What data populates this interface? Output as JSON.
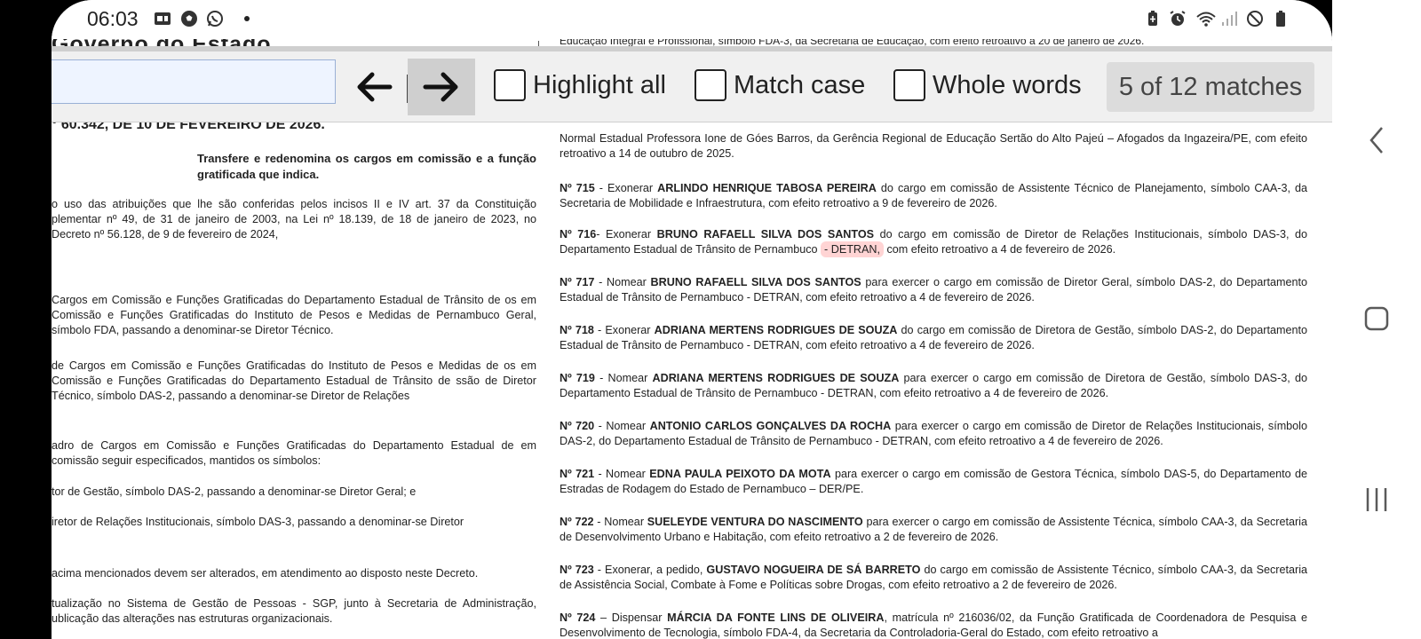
{
  "status_bar": {
    "time": "06:03",
    "left_icons": [
      "sim-card-icon",
      "football-icon",
      "whatsapp-icon"
    ],
    "right_icons": [
      "battery-saver-icon",
      "alarm-icon",
      "wifi-icon",
      "signal-icon",
      "do-not-disturb-icon",
      "battery-icon"
    ]
  },
  "find_bar": {
    "search_value": "",
    "prev_label": "←",
    "next_label": "→",
    "highlight_all": "Highlight all",
    "match_case": "Match case",
    "whole_words": "Whole words",
    "match_count": "5 of 12 matches"
  },
  "document": {
    "header_clipped": "Governo do Estado",
    "top_right_clipped": "Educação Integral e Profissional, símbolo FDA-3, da Secretaria de Educação, com efeito retroativo a 20 de janeiro de 2026.",
    "decree_title": "° 60.342, DE 10 DE FEVEREIRO DE 2026.",
    "ementa": "Transfere e redenomina os cargos em comissão e a função gratificada que indica.",
    "left_paragraphs": [
      "o uso das atribuições que lhe são conferidas pelos incisos II e IV art. 37 da Constituição plementar nº 49, de 31 de janeiro de 2003, na Lei nº 18.139, de 18 de janeiro de 2023, no Decreto nº 56.128, de 9 de fevereiro de 2024,",
      "Cargos em Comissão e Funções Gratificadas do Departamento Estadual de Trânsito de os em Comissão e Funções Gratificadas do Instituto de Pesos e Medidas de Pernambuco Geral, símbolo FDA, passando a denominar-se Diretor Técnico.",
      "de Cargos em Comissão e Funções Gratificadas do Instituto de Pesos e Medidas de os em Comissão e Funções Gratificadas do Departamento Estadual de Trânsito de ssão de Diretor Técnico, símbolo DAS-2, passando a denominar-se Diretor de Relações",
      "adro de Cargos em Comissão e Funções Gratificadas do Departamento Estadual de em comissão seguir especificados, mantidos os símbolos:",
      "tor de Gestão, símbolo DAS-2, passando a denominar-se Diretor Geral; e",
      "iretor de Relações Institucionais, símbolo DAS-3, passando a denominar-se Diretor",
      "acima mencionados devem ser alterados, em atendimento ao disposto neste Decreto.",
      "tualização no Sistema de Gestão de Pessoas - SGP, junto à Secretaria de Administração, ublicação das alterações nas estruturas organizacionais."
    ],
    "right_top": "Normal Estadual Professora Ione de Góes Barros, da Gerência Regional de Educação Sertão do Alto Pajeú – Afogados da Ingazeira/PE, com efeito retroativo a 14 de outubro de 2025.",
    "acts": [
      {
        "num": "Nº 715",
        "verb": " - Exonerar ",
        "name": "ARLINDO HENRIQUE TABOSA PEREIRA",
        "rest": " do cargo em comissão de Assistente Técnico de Planejamento, símbolo CAA-3, da Secretaria de Mobilidade e Infraestrutura, com efeito retroativo a 9 de fevereiro de 2026."
      },
      {
        "num": "Nº 716",
        "verb": "- Exonerar ",
        "name": "BRUNO RAFAELL SILVA DOS SANTOS",
        "rest_a": " do cargo em comissão de Diretor de Relações Institucionais, símbolo DAS-3, do Departamento Estadual de Trânsito de Pernambuco ",
        "highlight": "- DETRAN,",
        "rest_b": " com efeito retroativo a 4 de fevereiro de 2026."
      },
      {
        "num": "Nº 717",
        "verb": " - Nomear ",
        "name": "BRUNO RAFAELL SILVA DOS SANTOS",
        "rest": " para exercer o cargo em comissão de Diretor Geral, símbolo DAS-2, do Departamento Estadual de Trânsito de Pernambuco - DETRAN, com efeito retroativo a 4 de fevereiro de 2026."
      },
      {
        "num": "Nº 718",
        "verb": " - Exonerar ",
        "name": "ADRIANA MERTENS RODRIGUES DE SOUZA",
        "rest": " do cargo em comissão de Diretora de Gestão, símbolo DAS-2, do Departamento Estadual de Trânsito de Pernambuco - DETRAN, com efeito retroativo a 4 de fevereiro de 2026."
      },
      {
        "num": "Nº 719",
        "verb": " - Nomear ",
        "name": "ADRIANA MERTENS RODRIGUES DE SOUZA",
        "rest": " para exercer o cargo em comissão de Diretora de Gestão, símbolo DAS-3, do Departamento Estadual de Trânsito de Pernambuco - DETRAN, com efeito retroativo a 4 de fevereiro de 2026."
      },
      {
        "num": "Nº 720",
        "verb": " - Nomear ",
        "name": "ANTONIO CARLOS GONÇALVES DA ROCHA",
        "rest": " para exercer o cargo em comissão de Diretor de Relações Institucionais, símbolo DAS-2, do Departamento Estadual de Trânsito de Pernambuco - DETRAN, com efeito retroativo a 4 de fevereiro de 2026."
      },
      {
        "num": "Nº 721",
        "verb": " - Nomear ",
        "name": "EDNA PAULA PEIXOTO DA MOTA",
        "rest": " para exercer o cargo em comissão de Gestora Técnica, símbolo DAS-5, do Departamento de Estradas de Rodagem do Estado de Pernambuco – DER/PE."
      },
      {
        "num": "Nº 722",
        "verb": " - Nomear ",
        "name": "SUELEYDE VENTURA DO NASCIMENTO",
        "rest": " para exercer o cargo em comissão de Assistente Técnica, símbolo CAA-3, da Secretaria de Desenvolvimento Urbano e Habitação, com efeito retroativo a 2 de fevereiro de 2026."
      },
      {
        "num": "Nº 723",
        "verb": " - Exonerar, a pedido, ",
        "name": "GUSTAVO NOGUEIRA DE SÁ BARRETO",
        "rest": " do cargo em comissão de Assistente Técnico, símbolo CAA-3, da Secretaria de Assistência Social, Combate à Fome e Políticas sobre Drogas, com efeito retroativo a 2 de fevereiro de 2026."
      },
      {
        "num": "Nº 724",
        "verb": " – Dispensar ",
        "name": "MÁRCIA DA FONTE LINS DE OLIVEIRA",
        "rest": ", matrícula nº 216036/02, da Função Gratificada de Coordenadora de Pesquisa e Desenvolvimento de Tecnologia, símbolo FDA-4, da Secretaria da Controladoria-Geral do Estado, com efeito retroativo a"
      }
    ]
  },
  "nav_bar": {
    "icons": [
      "back-chevron-icon",
      "home-icon",
      "recents-icon"
    ]
  },
  "colors": {
    "highlight": "#ffd4d4",
    "findbar_bg": "#f0f0f0",
    "active_button": "#cfcfcf"
  }
}
